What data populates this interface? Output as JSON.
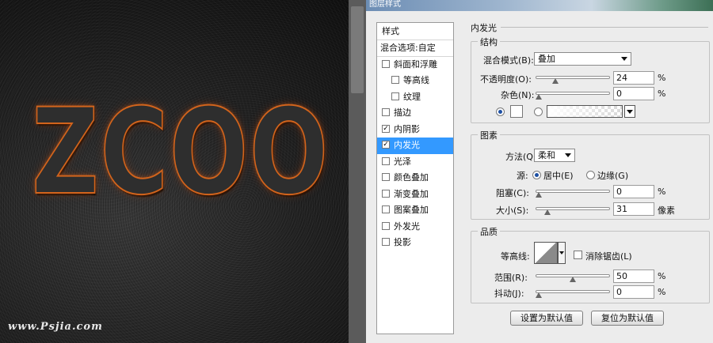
{
  "canvas": {
    "art_text": "ZCOO",
    "watermark": "www.Psjia.com"
  },
  "dialog": {
    "title": "图层样式",
    "style_list": {
      "header": "样式",
      "blend_options": "混合选项:自定",
      "items": [
        {
          "label": "斜面和浮雕",
          "checked": false,
          "sub": false
        },
        {
          "label": "等高线",
          "checked": false,
          "sub": true
        },
        {
          "label": "纹理",
          "checked": false,
          "sub": true
        },
        {
          "label": "描边",
          "checked": false,
          "sub": false
        },
        {
          "label": "内阴影",
          "checked": true,
          "sub": false
        },
        {
          "label": "内发光",
          "checked": true,
          "sub": false,
          "selected": true
        },
        {
          "label": "光泽",
          "checked": false,
          "sub": false
        },
        {
          "label": "颜色叠加",
          "checked": false,
          "sub": false
        },
        {
          "label": "渐变叠加",
          "checked": false,
          "sub": false
        },
        {
          "label": "图案叠加",
          "checked": false,
          "sub": false
        },
        {
          "label": "外发光",
          "checked": false,
          "sub": false
        },
        {
          "label": "投影",
          "checked": false,
          "sub": false
        }
      ]
    },
    "panel_title": "内发光",
    "structure": {
      "label": "结构",
      "blend_mode_label": "混合模式(B):",
      "blend_mode_value": "叠加",
      "opacity_label": "不透明度(O):",
      "opacity_value": "24",
      "opacity_level": 0.24,
      "noise_label": "杂色(N):",
      "noise_value": "0",
      "noise_level": 0,
      "percent": "%"
    },
    "elements": {
      "label": "图素",
      "method_label": "方法(Q):",
      "method_value": "柔和",
      "source_label": "源:",
      "source_center": "居中(E)",
      "source_edge": "边缘(G)",
      "choke_label": "阻塞(C):",
      "choke_value": "0",
      "choke_level": 0,
      "size_label": "大小(S):",
      "size_value": "31",
      "size_level": 0.124,
      "size_unit": "像素",
      "percent": "%"
    },
    "quality": {
      "label": "品质",
      "contour_label": "等高线:",
      "antialias_label": "消除锯齿(L)",
      "range_label": "范围(R):",
      "range_value": "50",
      "range_level": 0.5,
      "jitter_label": "抖动(J):",
      "jitter_value": "0",
      "jitter_level": 0,
      "percent": "%"
    },
    "buttons": {
      "make_default": "设置为默认值",
      "reset_default": "复位为默认值"
    }
  }
}
